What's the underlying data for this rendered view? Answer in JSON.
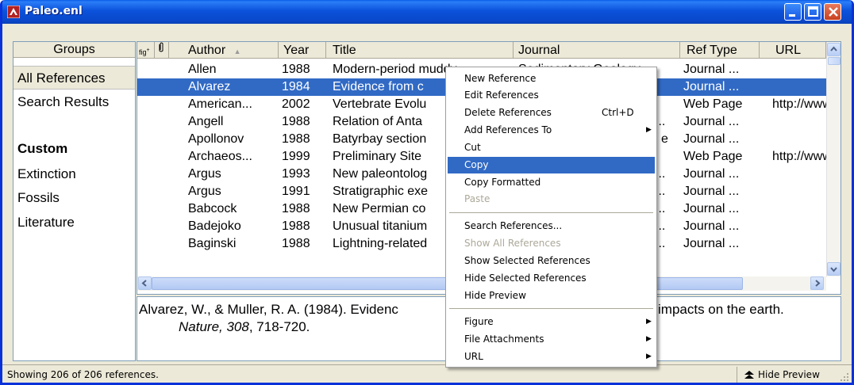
{
  "window": {
    "title": "Paleo.enl"
  },
  "groups": {
    "header": "Groups",
    "items": [
      {
        "label": "All References"
      },
      {
        "label": "Search Results"
      }
    ],
    "custom_label": "Custom",
    "custom_items": [
      {
        "label": "Extinction"
      },
      {
        "label": "Fossils"
      },
      {
        "label": "Literature"
      }
    ]
  },
  "references": {
    "columns": {
      "figure": "fig",
      "attachment": "0",
      "author": "Author",
      "year": "Year",
      "title": "Title",
      "journal": "Journal",
      "ref_type": "Ref Type",
      "url": "URL"
    },
    "sort_indicator": "▲",
    "rows": [
      {
        "author": "Allen",
        "year": "1988",
        "title": "Modern-period muddy",
        "journal": "Sedimentary Geology",
        "ref_type": "Journal ...",
        "url": ""
      },
      {
        "author": "Alvarez",
        "year": "1984",
        "title": "Evidence from c",
        "journal": "",
        "ref_type": "Journal ...",
        "url": ""
      },
      {
        "author": "American...",
        "year": "2002",
        "title": "Vertebrate Evolu",
        "journal": "",
        "ref_type": "Web Page",
        "url": "http://www"
      },
      {
        "author": "Angell",
        "year": "1988",
        "title": "Relation of Anta",
        "journal": "...",
        "ref_type": "Journal ...",
        "url": ""
      },
      {
        "author": "Apollonov",
        "year": "1988",
        "title": "Batyrbay section",
        "journal": "e",
        "ref_type": "Journal ...",
        "url": ""
      },
      {
        "author": "Archaeos...",
        "year": "1999",
        "title": "Preliminary Site",
        "journal": "",
        "ref_type": "Web Page",
        "url": "http://www"
      },
      {
        "author": "Argus",
        "year": "1993",
        "title": "New paleontolog",
        "journal": "...",
        "ref_type": "Journal ...",
        "url": ""
      },
      {
        "author": "Argus",
        "year": "1991",
        "title": "Stratigraphic exe",
        "journal": "...",
        "ref_type": "Journal ...",
        "url": ""
      },
      {
        "author": "Babcock",
        "year": "1988",
        "title": "New Permian co",
        "journal": "...",
        "ref_type": "Journal ...",
        "url": ""
      },
      {
        "author": "Badejoko",
        "year": "1988",
        "title": "Unusual titanium",
        "journal": "...",
        "ref_type": "Journal ...",
        "url": ""
      },
      {
        "author": "Baginski",
        "year": "1988",
        "title": "Lightning-related",
        "journal": "...",
        "ref_type": "Journal ...",
        "url": ""
      }
    ]
  },
  "preview": {
    "line1": "Alvarez, W., & Muller, R. A. (1984). Evidenc",
    "line1_end": "impacts on the earth.",
    "journal": "Nature, 308",
    "pages": ", 718-720."
  },
  "status": {
    "text": "Showing 206 of 206 references.",
    "hide_preview": "Hide Preview"
  },
  "context_menu": {
    "items": [
      {
        "label": "New Reference"
      },
      {
        "label": "Edit References"
      },
      {
        "label": "Delete References",
        "shortcut": "Ctrl+D"
      },
      {
        "label": "Add References To"
      },
      {
        "label": "Cut"
      },
      {
        "label": "Copy"
      },
      {
        "label": "Copy Formatted"
      },
      {
        "label": "Paste"
      },
      {
        "label": "Search References..."
      },
      {
        "label": "Show All References"
      },
      {
        "label": "Show Selected References"
      },
      {
        "label": "Hide Selected References"
      },
      {
        "label": "Hide Preview"
      },
      {
        "label": "Figure"
      },
      {
        "label": "File Attachments"
      },
      {
        "label": "URL"
      }
    ]
  },
  "colors": {
    "selection": "#316ac5",
    "titlebar": "#0a5ee8",
    "window_bg": "#ece9d8"
  }
}
